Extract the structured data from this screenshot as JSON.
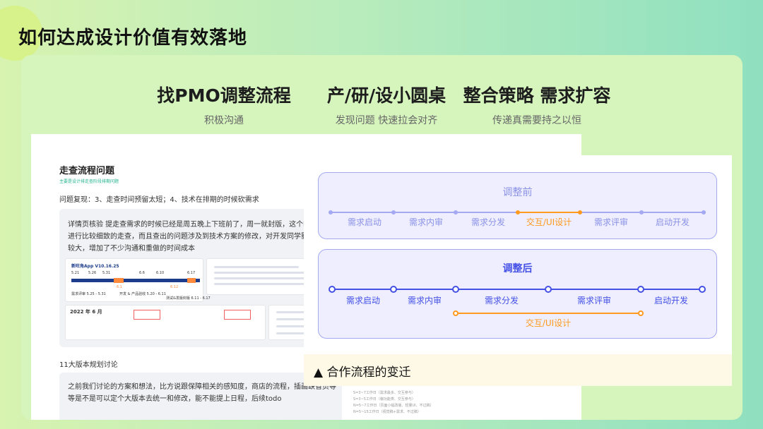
{
  "page_title": "如何达成设计价值有效落地",
  "columns": [
    {
      "heading": "找PMO调整流程",
      "sub": "积极沟通"
    },
    {
      "heading": "产/研/设小圆桌",
      "sub": "发现问题 快速拉会对齐"
    },
    {
      "heading": "整合策略 需求扩容",
      "sub": "传递真需要持之以恒"
    }
  ],
  "doc": {
    "title": "走查流程问题",
    "subtitle": "主要是设计排走查阶段排期问题",
    "problem": "问题复现：3、走查时间预留太短；4、技术在排期的时候砍需求",
    "detail": "详情页核验 提走查需求的时候已经是周五晚上下班前了，周一就封版，这个时间进行比较细致的走查，而且查出的问题涉及到技术方案的修改，对开发同学影响比较大，增加了不少沟通和重做的时间成本",
    "timeline_title": "新旺角App V10.16.25",
    "timeline_labels": [
      "5.21",
      "5.26",
      "5.31",
      "6.1",
      "6.6",
      "6.10",
      "6.12",
      "6.17"
    ],
    "timeline_phases": [
      "需求评审 5.25 - 5.31",
      "开发 & 产品验收 5.20 - 6.11",
      "测试&发版封版 6.11 - 6.17"
    ],
    "calendar_title": "2022 年 6 月",
    "section2": "11大版本规划讨论",
    "section2_text": "之前我们讨论的方案和想法，比方说跟保障相关的感知度，商店的流程，插画缺省页等等是不是可以定个大版本去统一和修改，能不能提上日程，后续todo",
    "faint_lines": [
      "S=3~7工作日（需求最多、交互参与）",
      "S=3~5工作日（偏功能类、交互参与）",
      "N=5~7工作日（页面小幅改版、轻量UI、不过稿）",
      "N=5~15工作日（视觉稿+需求、不过稿）"
    ]
  },
  "flow": {
    "before_title": "调整前",
    "before_steps": [
      "需求启动",
      "需求内审",
      "需求分发",
      "交互/UI设计",
      "需求评审",
      "启动开发"
    ],
    "after_title": "调整后",
    "after_steps": [
      "需求启动",
      "需求内审",
      "需求分发",
      "需求评审",
      "启动开发"
    ],
    "after_parallel": "交互/UI设计",
    "caption": "▲ 合作流程的变迁"
  },
  "colors": {
    "accent_orange": "#ff9a1f",
    "flow_blue": "#4450e6",
    "faint_blue": "#a4a9f2",
    "faint_label": "#8b92e6"
  }
}
